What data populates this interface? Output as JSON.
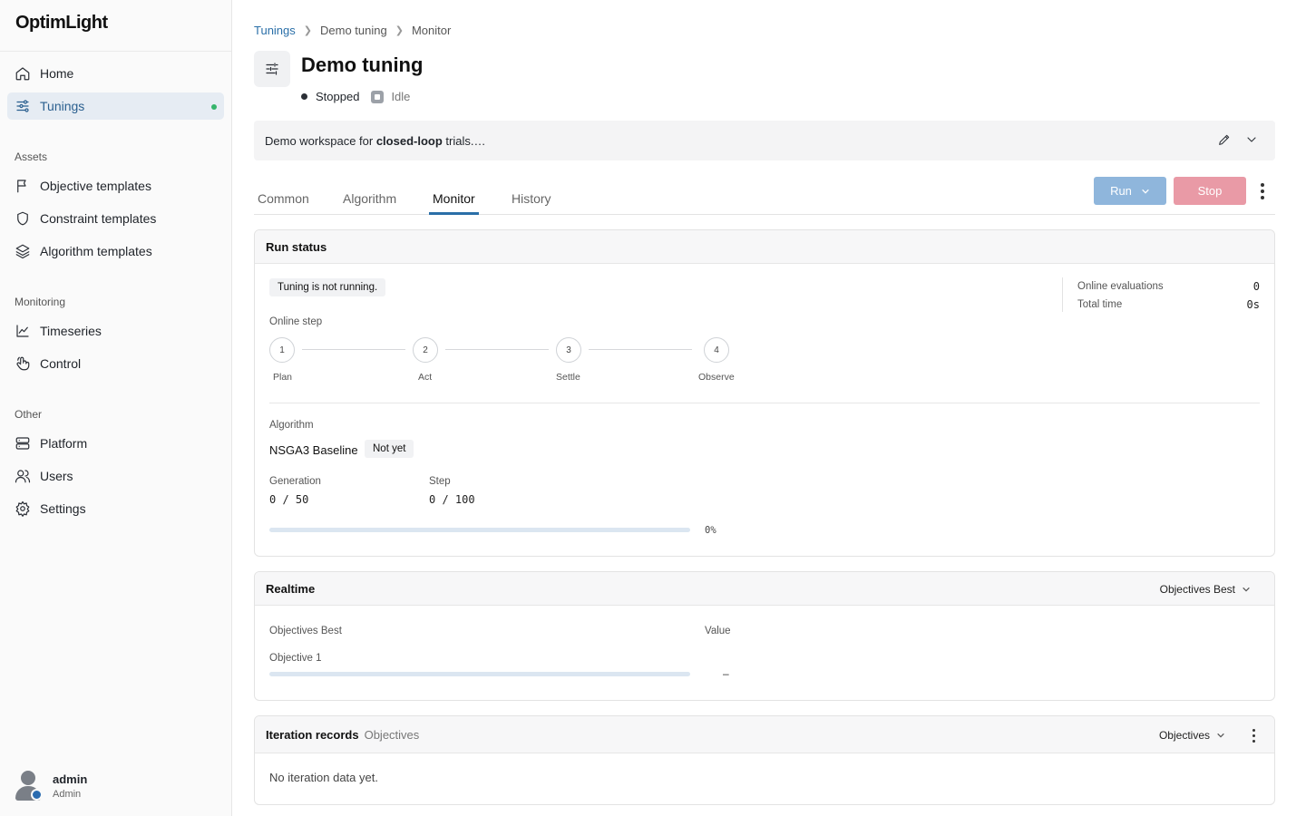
{
  "app": {
    "name": "OptimLight"
  },
  "sidebar": {
    "items": [
      {
        "label": "Home",
        "icon": "home-icon"
      },
      {
        "label": "Tunings",
        "icon": "sliders-icon",
        "active": true
      }
    ],
    "sections": [
      {
        "title": "Assets",
        "items": [
          {
            "label": "Objective templates",
            "icon": "flag-icon"
          },
          {
            "label": "Constraint templates",
            "icon": "shield-icon"
          },
          {
            "label": "Algorithm templates",
            "icon": "layers-icon"
          }
        ]
      },
      {
        "title": "Monitoring",
        "items": [
          {
            "label": "Timeseries",
            "icon": "line-chart-icon"
          },
          {
            "label": "Control",
            "icon": "pointer-icon"
          }
        ]
      },
      {
        "title": "Other",
        "items": [
          {
            "label": "Platform",
            "icon": "server-icon"
          },
          {
            "label": "Users",
            "icon": "users-icon"
          },
          {
            "label": "Settings",
            "icon": "gear-icon"
          }
        ]
      }
    ],
    "user": {
      "name": "admin",
      "role": "Admin"
    }
  },
  "breadcrumb": [
    "Tunings",
    "Demo tuning",
    "Monitor"
  ],
  "header": {
    "title": "Demo tuning",
    "status": "Stopped",
    "state": "Idle",
    "description_prefix": "Demo workspace for ",
    "description_bold": "closed-loop",
    "description_suffix": " trials.…"
  },
  "tabs": [
    {
      "label": "Common"
    },
    {
      "label": "Algorithm"
    },
    {
      "label": "Monitor",
      "active": true
    },
    {
      "label": "History"
    }
  ],
  "actions": {
    "run_label": "Run",
    "stop_label": "Stop"
  },
  "run_status": {
    "title": "Run status",
    "message": "Tuning is not running.",
    "online_step_label": "Online step",
    "steps": [
      {
        "num": "1",
        "label": "Plan"
      },
      {
        "num": "2",
        "label": "Act"
      },
      {
        "num": "3",
        "label": "Settle"
      },
      {
        "num": "4",
        "label": "Observe"
      }
    ],
    "stats": [
      {
        "label": "Online evaluations",
        "value": "0"
      },
      {
        "label": "Total time",
        "value": "0s"
      }
    ],
    "algorithm_label": "Algorithm",
    "algorithm_name": "NSGA3 Baseline",
    "algorithm_badge": "Not yet",
    "generation_label": "Generation",
    "generation_value": "0 / 50",
    "step_label": "Step",
    "step_value": "0 / 100",
    "progress_text": "0%",
    "progress": 0
  },
  "realtime": {
    "title": "Realtime",
    "selector": "Objectives Best",
    "col_name": "Objectives Best",
    "col_value": "Value",
    "rows": [
      {
        "name": "Objective 1",
        "value": "–"
      }
    ]
  },
  "iteration": {
    "title": "Iteration records",
    "subtitle": "Objectives",
    "selector": "Objectives",
    "empty": "No iteration data yet."
  },
  "colors": {
    "accent": "#2a6fa8",
    "run_button": "#8fb6dc",
    "stop_button": "#e99aa6",
    "active_dot": "#35b46b"
  }
}
